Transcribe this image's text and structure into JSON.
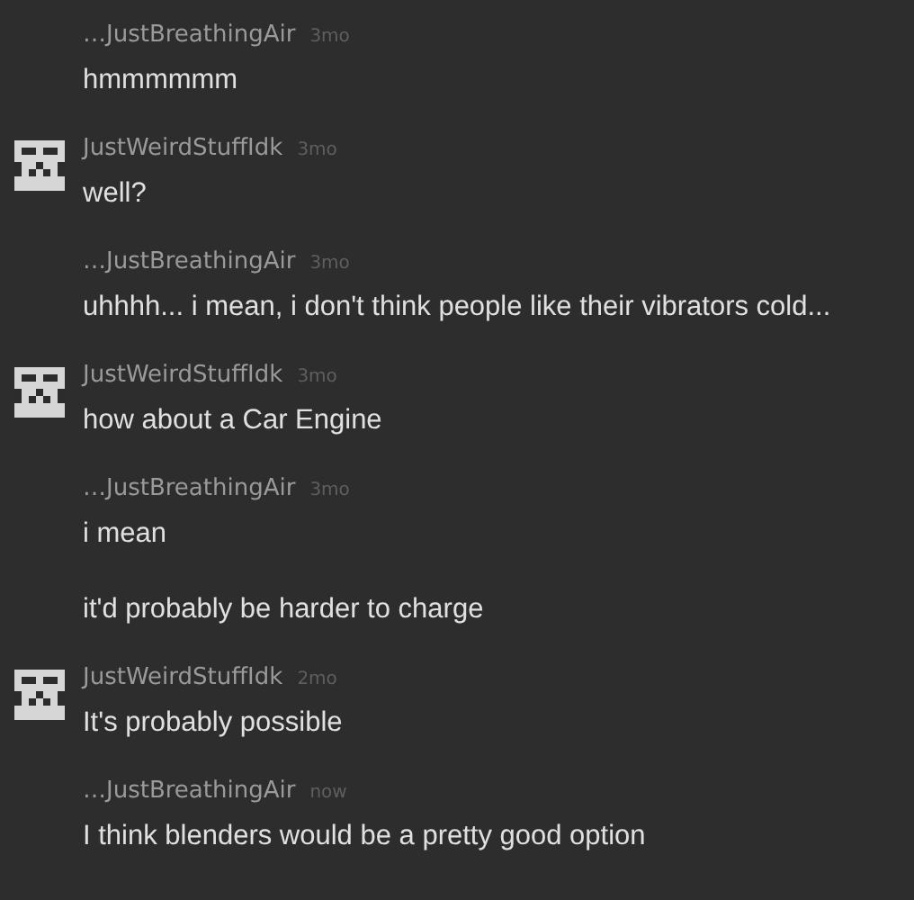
{
  "comments": [
    {
      "author": "…JustBreathingAir",
      "time": "3mo",
      "avatar": false,
      "paragraphs": [
        "hmmmmmm"
      ]
    },
    {
      "author": "JustWeirdStuffIdk",
      "time": "3mo",
      "avatar": true,
      "paragraphs": [
        "well?"
      ]
    },
    {
      "author": "…JustBreathingAir",
      "time": "3mo",
      "avatar": false,
      "paragraphs": [
        "uhhhh... i mean, i don't think people like their vibrators cold..."
      ]
    },
    {
      "author": "JustWeirdStuffIdk",
      "time": "3mo",
      "avatar": true,
      "paragraphs": [
        "how about a Car Engine"
      ]
    },
    {
      "author": "…JustBreathingAir",
      "time": "3mo",
      "avatar": false,
      "paragraphs": [
        "i mean",
        "it'd probably be harder to charge"
      ]
    },
    {
      "author": "JustWeirdStuffIdk",
      "time": "2mo",
      "avatar": true,
      "paragraphs": [
        "It's probably possible"
      ]
    },
    {
      "author": "…JustBreathingAir",
      "time": "now",
      "avatar": false,
      "paragraphs": [
        "I think blenders would be a pretty good option"
      ]
    }
  ]
}
